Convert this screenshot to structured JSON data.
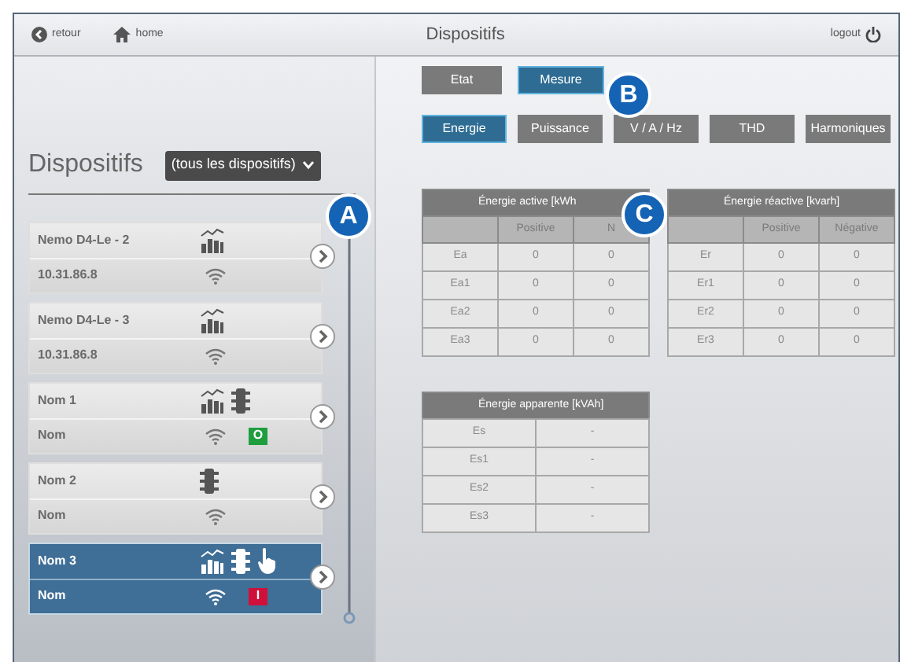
{
  "header": {
    "back": "retour",
    "home": "home",
    "title": "Dispositifs",
    "logout": "logout"
  },
  "sidebar": {
    "title": "Dispositifs",
    "filter": "(tous les dispositifs)",
    "devices": [
      {
        "name": "Nemo D4-Le - 2",
        "address": "10.31.86.8",
        "chart": true,
        "traffic_light": false,
        "hand": false,
        "selected": false
      },
      {
        "name": "Nemo D4-Le - 3",
        "address": "10.31.86.8",
        "chart": true,
        "traffic_light": false,
        "hand": false,
        "selected": false
      },
      {
        "name": "Nom 1",
        "address": "Nom",
        "chart": true,
        "traffic_light": true,
        "hand": false,
        "status": {
          "text": "O",
          "color": "#1e9e3e"
        },
        "selected": false
      },
      {
        "name": "Nom 2",
        "address": "Nom",
        "chart": false,
        "traffic_light": true,
        "hand": false,
        "selected": false
      },
      {
        "name": "Nom 3",
        "address": "Nom",
        "chart": true,
        "traffic_light": true,
        "hand": true,
        "status": {
          "text": "I",
          "color": "#d0103a"
        },
        "selected": true
      }
    ]
  },
  "mode_tabs": [
    {
      "label": "Etat",
      "selected": false
    },
    {
      "label": "Mesure",
      "selected": true
    }
  ],
  "measure_tabs": [
    {
      "label": "Energie",
      "selected": true
    },
    {
      "label": "Puissance",
      "selected": false
    },
    {
      "label": "V / A / Hz",
      "selected": false
    },
    {
      "label": "THD",
      "selected": false
    },
    {
      "label": "Harmoniques",
      "selected": false
    }
  ],
  "tables": [
    {
      "title": "Énergie active [kWh",
      "columns": [
        "",
        "Positive",
        "N"
      ],
      "rows": [
        [
          "Ea",
          "0",
          "0"
        ],
        [
          "Ea1",
          "0",
          "0"
        ],
        [
          "Ea2",
          "0",
          "0"
        ],
        [
          "Ea3",
          "0",
          "0"
        ]
      ]
    },
    {
      "title": "Énergie réactive [kvarh]",
      "columns": [
        "",
        "Positive",
        "Négative"
      ],
      "rows": [
        [
          "Er",
          "0",
          "0"
        ],
        [
          "Er1",
          "0",
          "0"
        ],
        [
          "Er2",
          "0",
          "0"
        ],
        [
          "Er3",
          "0",
          "0"
        ]
      ]
    },
    {
      "title": "Énergie apparente [kVAh]",
      "rows": [
        [
          "Es",
          "-"
        ],
        [
          "Es1",
          "-"
        ],
        [
          "Es2",
          "-"
        ],
        [
          "Es3",
          "-"
        ]
      ]
    }
  ],
  "callouts": [
    "A",
    "B",
    "C"
  ]
}
